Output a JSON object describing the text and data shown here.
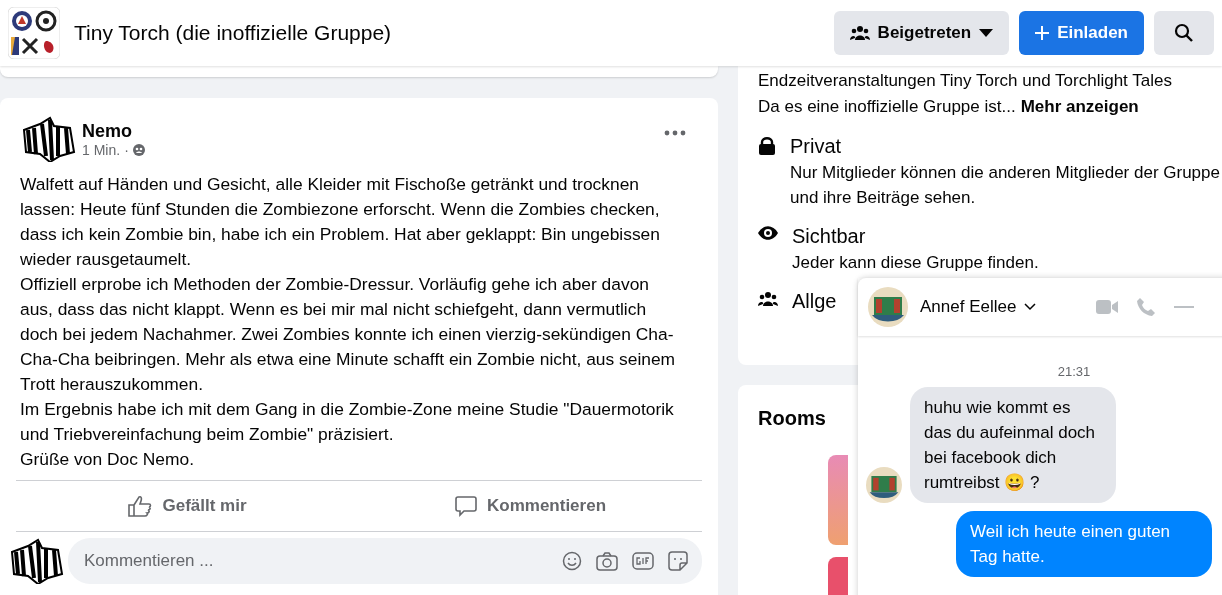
{
  "header": {
    "group_name": "Tiny Torch (die inoffizielle Gruppe)",
    "buttons": [
      {
        "kind": "joined",
        "label": "Beigetreten"
      },
      {
        "kind": "invite",
        "label": "Einladen"
      },
      {
        "kind": "search"
      }
    ]
  },
  "post": {
    "author": "Nemo",
    "time": "1 Min.",
    "separator": "·",
    "paragraphs": [
      "Walfett auf Händen und Gesicht, alle Kleider mit Fischoße getränkt und trocknen lassen: Heute fünf Stunden die Zombiezone erforscht. Wenn die Zombies checken, dass ich kein Zombie bin, habe ich ein Problem. Hat aber geklappt: Bin ungebissen wieder rausgetaumelt.",
      "Offiziell erprobe ich Methoden der Zombie-Dressur. Vorläufig gehe ich aber davon aus, dass das nicht klappt. Wenn es bei mir mal nicht schiefgeht, dann vermutlich doch bei jedem Nachahmer. Zwei Zombies konnte ich einen vierzig-sekündigen Cha-Cha-Cha beibringen. Mehr als etwa eine Minute schafft ein Zombie nicht, aus seinem Trott herauszukommen.",
      "Im Ergebnis habe ich mit dem Gang in die Zombie-Zone meine Studie \"Dauermotorik und Triebvereinfachung beim Zombie\" präzisiert.",
      "Grüße von Doc Nemo."
    ],
    "actions": [
      {
        "kind": "like",
        "label": "Gefällt mir"
      },
      {
        "kind": "comment",
        "label": "Kommentieren"
      }
    ],
    "comment_field": {
      "placeholder": "Kommentieren ..."
    }
  },
  "about": {
    "description_line": "Endzeitveranstaltungen Tiny Torch und Torchlight Tales",
    "description_more": "Da es eine inoffizielle Gruppe ist...",
    "more_link": "Mehr anzeigen",
    "items": [
      {
        "kind": "lock",
        "title": "Privat",
        "text": "Nur Mitglieder können die anderen Mitglieder der Gruppe und ihre Beiträge sehen."
      },
      {
        "kind": "eye",
        "title": "Sichtbar",
        "text": "Jeder kann diese Gruppe finden."
      },
      {
        "kind": "people",
        "title": "Allge"
      }
    ]
  },
  "rooms": {
    "title": "Rooms"
  },
  "chat": {
    "contact": "Annef Eellee",
    "time": "21:31",
    "messages": [
      {
        "kind": "received",
        "text": "huhu wie kommt es das du aufeinmal doch bei facebook dich rumtreibst",
        "emoji": "😀",
        "tail": "?"
      },
      {
        "kind": "sent",
        "text": "Weil ich heute einen guten Tag hatte."
      }
    ]
  }
}
